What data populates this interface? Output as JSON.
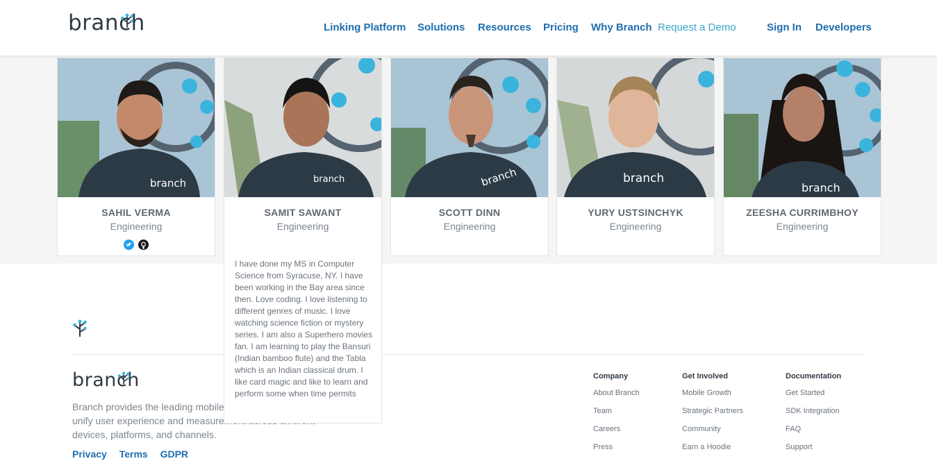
{
  "header": {
    "logo_text": "branch",
    "nav": [
      {
        "label": "Linking Platform",
        "style": "primary"
      },
      {
        "label": "Solutions",
        "style": "primary"
      },
      {
        "label": "Resources",
        "style": "primary"
      },
      {
        "label": "Pricing",
        "style": "primary"
      },
      {
        "label": "Why Branch",
        "style": "primary"
      },
      {
        "label": "Request a Demo",
        "style": "light"
      },
      {
        "label": "Sign In",
        "style": "primary"
      },
      {
        "label": "Developers",
        "style": "primary"
      }
    ]
  },
  "team": [
    {
      "name": "SAHIL VERMA",
      "role": "Engineering",
      "social": [
        "twitter-icon",
        "github-icon"
      ]
    },
    {
      "name": "SAMIT SAWANT",
      "role": "Engineering",
      "bio": "I have done my MS in Computer Science from Syracuse, NY. I have been working in the Bay area since then. Love coding.  I love listening to different genres of music. I love watching science fiction or mystery series. I am also a Superhero movies fan. I am learning to play the Bansuri (Indian bamboo flute) and the Tabla which is an Indian classical drum. I like card magic and like to learn and perform some when time permits"
    },
    {
      "name": "SCOTT DINN",
      "role": "Engineering"
    },
    {
      "name": "YURY USTSINCHYK",
      "role": "Engineering"
    },
    {
      "name": "ZEESHA CURRIMBHOY",
      "role": "Engineering"
    }
  ],
  "footer": {
    "logo_text": "branch",
    "description": "Branch provides the leading mobile linking solutions that unify user experience and measurement across different devices, platforms, and channels.",
    "links": [
      "Privacy",
      "Terms",
      "GDPR"
    ],
    "columns": [
      {
        "heading": "Company",
        "items": [
          "About Branch",
          "Team",
          "Careers",
          "Press"
        ]
      },
      {
        "heading": "Get Involved",
        "items": [
          "Mobile Growth",
          "Strategic Partners",
          "Community",
          "Earn a Hoodie"
        ]
      },
      {
        "heading": "Documentation",
        "items": [
          "Get Started",
          "SDK Integration",
          "FAQ",
          "Support"
        ]
      }
    ]
  },
  "colors": {
    "nav_primary": "#1e6eb0",
    "nav_light": "#3aa6cc",
    "accent_dot": "#3ab4dc",
    "shirt": "#2c3a46"
  }
}
